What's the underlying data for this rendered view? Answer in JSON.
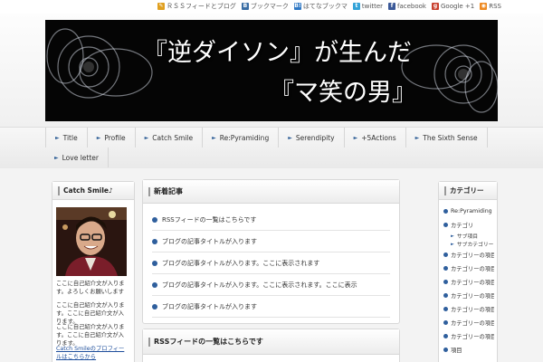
{
  "toplinks": [
    {
      "icon": "pencil-icon",
      "label": "ＲＳＳフィードとブログ",
      "color": "#e0a020"
    },
    {
      "icon": "bookmark-icon",
      "label": "ブックマーク",
      "color": "#3a6ea5"
    },
    {
      "icon": "hatena-icon",
      "label": "はてなブックマ",
      "color": "#2f78c4"
    },
    {
      "icon": "twitter-icon",
      "label": "twitter",
      "color": "#33a3d8"
    },
    {
      "icon": "facebook-icon",
      "label": "facebook",
      "color": "#3b5998"
    },
    {
      "icon": "google-plus-icon",
      "label": "Google +1",
      "color": "#c8402e"
    },
    {
      "icon": "rss-icon",
      "label": "RSS",
      "color": "#ee8a22"
    }
  ],
  "banner": {
    "line1": "『逆ダイソン』が生んだ",
    "line2": "『マ笑の男』"
  },
  "nav": [
    "Title",
    "Profile",
    "Catch Smile",
    "Re:Pyramiding",
    "Serendipity",
    "+5Actions",
    "The Sixth Sense",
    "Love letter"
  ],
  "left": {
    "title": "Catch Smile♪",
    "p1": "ここに自己紹介文が入ります。よろしくお願いします",
    "p2": "ここに自己紹介文が入ります。ここに自己紹介文が入ります。",
    "p3": "ここに自己紹介文が入ります。ここに自己紹介文が入ります。",
    "link": "Catch Smileのプロフィールはこちらから"
  },
  "center": {
    "title": "新着記事",
    "items": [
      "RSSフィードの一覧はこちらです",
      "ブログの記事タイトルが入ります",
      "ブログの記事タイトルが入ります。ここに表示されます",
      "ブログの記事タイトルが入ります。ここに表示されます。ここに表示",
      "ブログの記事タイトルが入ります"
    ],
    "title2": "RSSフィードの一覧はこちらです"
  },
  "right": {
    "title": "カテゴリー",
    "items": [
      {
        "label": "Re:Pyramiding",
        "subs": []
      },
      {
        "label": "カテゴリ",
        "subs": [
          "サブ項目",
          "サブカテゴリーの項目が入ります"
        ]
      },
      {
        "label": "カテゴリーの項目",
        "subs": []
      },
      {
        "label": "カテゴリーの項目が入ります",
        "subs": []
      },
      {
        "label": "カテゴリーの項目",
        "subs": []
      },
      {
        "label": "カテゴリーの項目が入",
        "subs": []
      },
      {
        "label": "カテゴリーの項目",
        "subs": []
      },
      {
        "label": "カテゴリーの項目が入ります",
        "subs": []
      },
      {
        "label": "カテゴリーの項目",
        "subs": []
      },
      {
        "label": "項目",
        "subs": []
      }
    ]
  },
  "colors": {
    "accent": "#2f5f9d",
    "banner_bg": "#050505"
  }
}
